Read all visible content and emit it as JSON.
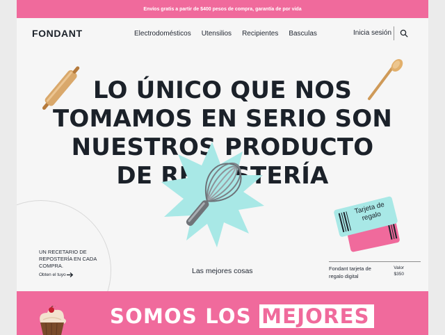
{
  "promo": {
    "text": "Envíos gratis a partir de $400 pesos de compra, garantía de por vida"
  },
  "nav": {
    "logo": "FONDANT",
    "items": [
      "Electrodomésticos",
      "Utensilios",
      "Recipientes",
      "Basculas"
    ],
    "login": "Inicia sesión",
    "search_icon": "search-icon"
  },
  "hero": {
    "headline_lines": [
      "LO ÚNICO QUE NOS",
      "TOMAMOS EN SERIO SON",
      "NUESTROS PRODUCTO",
      "DE REPOSTERÍA"
    ],
    "recetario": "UN RECETARIO DE REPOSTERÍA EN CADA COMPRA.",
    "obten": "Obten el tuyo",
    "mejores_cosas": "Las mejores cosas",
    "gift_card": {
      "ticket_text": "Tarjeta de regalo",
      "name": "Fondant tarjeta de regalo digital",
      "valor_label": "Valor",
      "valor_value": "$350"
    }
  },
  "band": {
    "text_plain": "SOMOS LOS",
    "text_highlight": "MEJORES"
  },
  "colors": {
    "pink": "#f06a9c",
    "mint": "#a8e8e6",
    "dark": "#1b2129",
    "wood": "#d9a86b"
  }
}
